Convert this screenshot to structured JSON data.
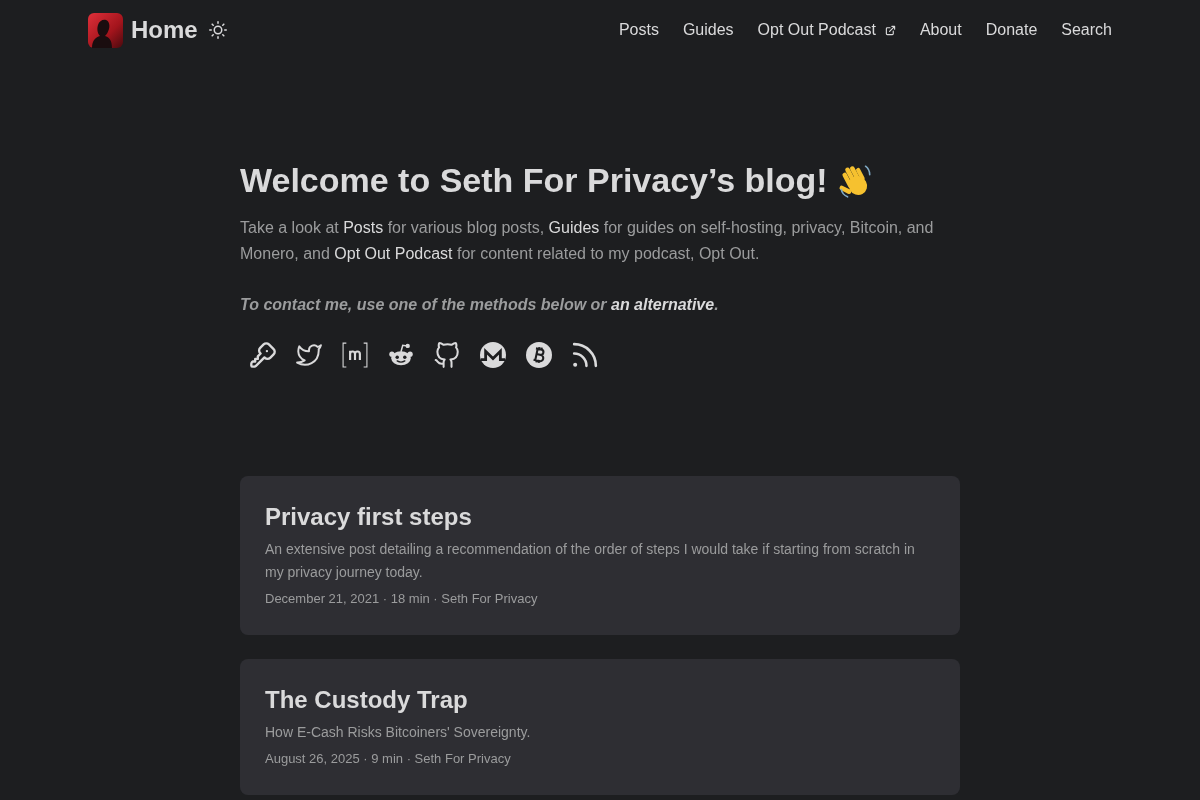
{
  "header": {
    "logo_text": "Home",
    "nav": [
      {
        "label": "Posts",
        "external": false
      },
      {
        "label": "Guides",
        "external": false
      },
      {
        "label": "Opt Out Podcast",
        "external": true
      },
      {
        "label": "About",
        "external": false
      },
      {
        "label": "Donate",
        "external": false
      },
      {
        "label": "Search",
        "external": false
      }
    ]
  },
  "hero": {
    "title": "Welcome to Seth For Privacy’s blog!",
    "intro": [
      {
        "kind": "text",
        "text": "Take a look at "
      },
      {
        "kind": "link",
        "text": "Posts"
      },
      {
        "kind": "text",
        "text": " for various blog posts, "
      },
      {
        "kind": "link",
        "text": "Guides"
      },
      {
        "kind": "text",
        "text": " for guides on self-hosting, privacy, Bitcoin, and Monero, and "
      },
      {
        "kind": "link",
        "text": "Opt Out Podcast"
      },
      {
        "kind": "text",
        "text": " for content related to my podcast, Opt Out."
      }
    ],
    "contact": [
      {
        "kind": "text",
        "text": "To contact me, use one of the methods below or "
      },
      {
        "kind": "link",
        "text": "an alternative"
      },
      {
        "kind": "text",
        "text": "."
      }
    ],
    "social_links": [
      {
        "kind": "key"
      },
      {
        "kind": "twitter"
      },
      {
        "kind": "matrix"
      },
      {
        "kind": "reddit"
      },
      {
        "kind": "github"
      },
      {
        "kind": "monero"
      },
      {
        "kind": "bitcoin"
      },
      {
        "kind": "rss"
      }
    ]
  },
  "posts": [
    {
      "title": "Privacy first steps",
      "description": "An extensive post detailing a recommendation of the order of steps I would take if starting from scratch in my privacy journey today.",
      "meta": "December 21, 2021 · 18 min · Seth For Privacy"
    },
    {
      "title": "The Custody Trap",
      "description": "How E-Cash Risks Bitcoiners' Sovereignty.",
      "meta": "August 26, 2025 · 9 min · Seth For Privacy"
    }
  ]
}
